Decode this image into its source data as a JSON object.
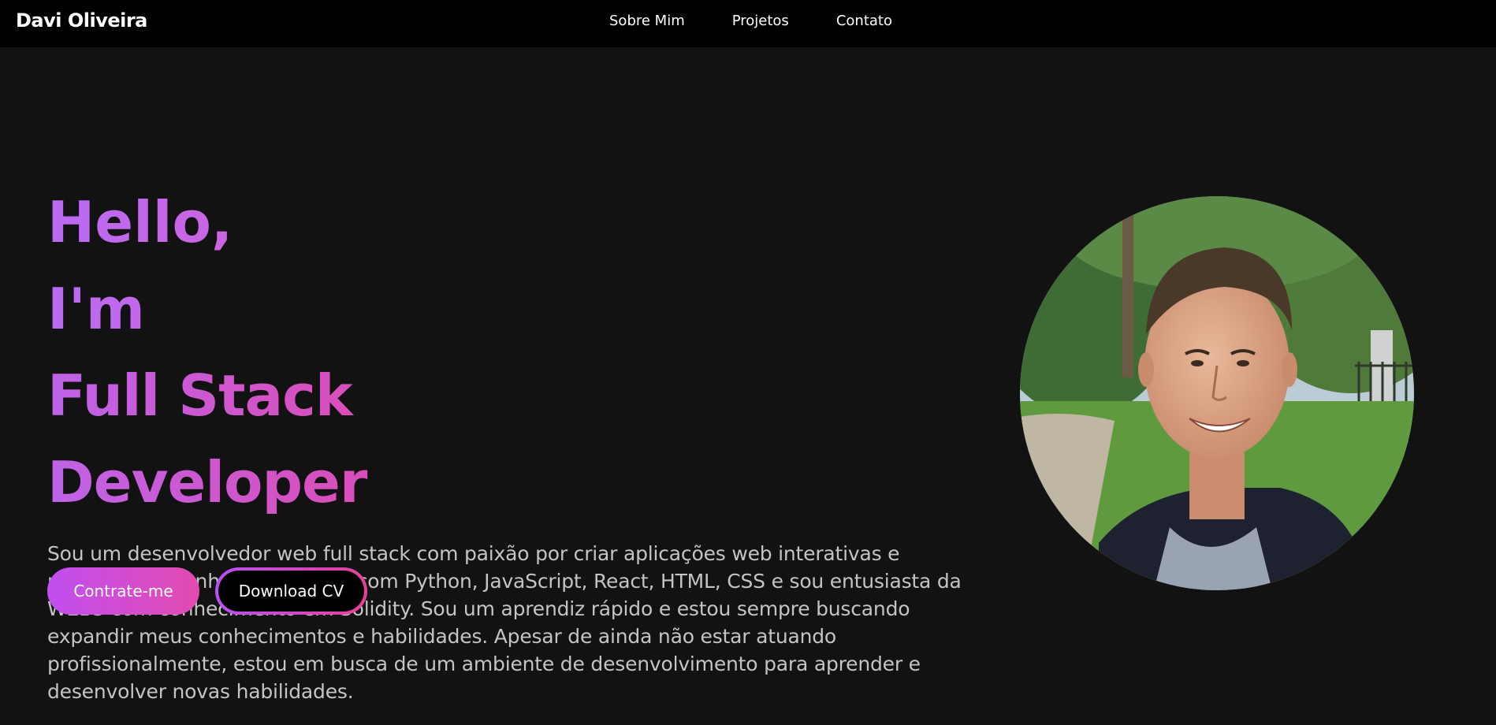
{
  "nav": {
    "brand": "Davi Oliveira",
    "links": [
      "Sobre Mim",
      "Projetos",
      "Contato"
    ]
  },
  "hero": {
    "greeting": "Hello, I'm",
    "role": "Full Stack Developer",
    "bio": "Sou um desenvolvedor web full stack com paixão por criar aplicações web interativas e responsivas. Tenho experiência com Python, JavaScript, React, HTML, CSS e sou entusiasta da WEB3 com conhecimento em Solidity. Sou um aprendiz rápido e estou sempre buscando expandir meus conhecimentos e habilidades. Apesar de ainda não estar atuando profissionalmente, estou em busca de um ambiente de desenvolvimento para aprender e desenvolver novas habilidades.",
    "primary_button": "Contrate-me",
    "secondary_button": "Download CV"
  },
  "colors": {
    "background": "#121212",
    "navbar": "#000000",
    "accent_purple": "#b86bf3",
    "accent_pink": "#f01a7a"
  }
}
